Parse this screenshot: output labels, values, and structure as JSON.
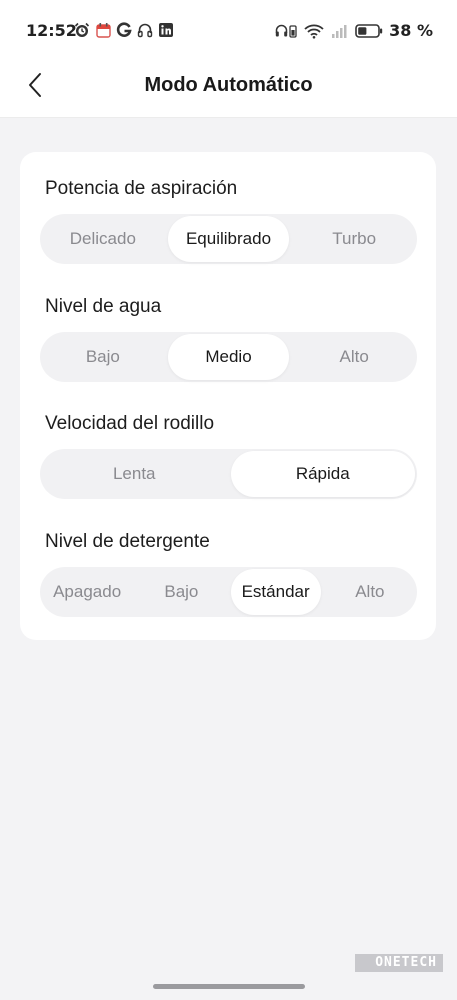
{
  "status_bar": {
    "time": "12:52",
    "battery": "38 %",
    "left_icons": [
      "alarm-icon",
      "calendar-icon",
      "g-icon",
      "headphones-icon",
      "linkedin-icon"
    ],
    "right_icons": [
      "headset-battery-icon",
      "wifi-icon",
      "signal-icon",
      "battery-icon"
    ]
  },
  "header": {
    "title": "Modo Automático"
  },
  "settings": [
    {
      "label": "Potencia de aspiración",
      "options": [
        "Delicado",
        "Equilibrado",
        "Turbo"
      ],
      "selected": "Equilibrado"
    },
    {
      "label": "Nivel de agua",
      "options": [
        "Bajo",
        "Medio",
        "Alto"
      ],
      "selected": "Medio"
    },
    {
      "label": "Velocidad del rodillo",
      "options": [
        "Lenta",
        "Rápida"
      ],
      "selected": "Rápida"
    },
    {
      "label": "Nivel de detergente",
      "options": [
        "Apagado",
        "Bajo",
        "Estándar",
        "Alto"
      ],
      "selected": "Estándar"
    }
  ],
  "watermark": {
    "text": "ONETECH"
  },
  "colors": {
    "background": "#f3f3f5",
    "card": "#ffffff",
    "segment_track": "#f1f1f3",
    "selected_text": "#1a1a1a",
    "unselected_text": "#8a8a8f"
  }
}
